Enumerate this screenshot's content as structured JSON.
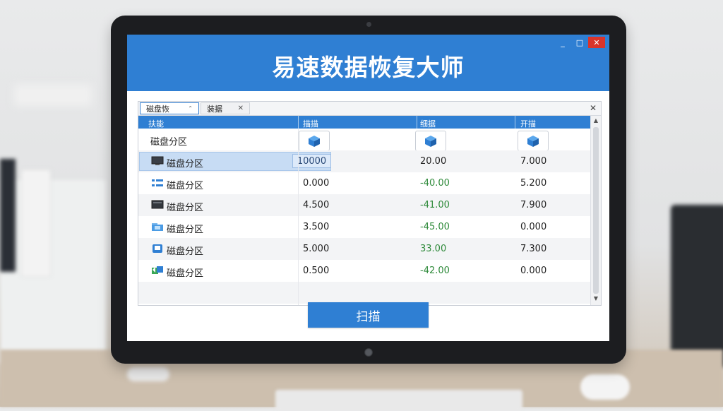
{
  "app": {
    "title": "易速数据恢复大师",
    "window_controls": [
      "_",
      "□",
      "✕"
    ]
  },
  "tabs": [
    {
      "label": "磁盘恢",
      "suffix": "⌃",
      "active": true
    },
    {
      "label": "装据",
      "suffix": "✕",
      "active": false
    }
  ],
  "panel_close": "✕",
  "table": {
    "headers": [
      "扶能",
      "描描",
      "细据",
      "开描"
    ],
    "icon_row_label": "磁盘分区",
    "rows": [
      {
        "icon": "monitor-icon",
        "name": "磁盘分区",
        "c1": "10000",
        "c2": "20.00",
        "c3": "7.000",
        "selected": true
      },
      {
        "icon": "network-icon",
        "name": "磁盘分区",
        "c1": "0.000",
        "c2": "-40.00",
        "c3": "5.200"
      },
      {
        "icon": "drive-icon",
        "name": "磁盘分区",
        "c1": "4.500",
        "c2": "-41.00",
        "c3": "7.900"
      },
      {
        "icon": "folder-icon",
        "name": "磁盘分区",
        "c1": "3.500",
        "c2": "-45.00",
        "c3": "0.000"
      },
      {
        "icon": "disk-icon",
        "name": "磁盘分区",
        "c1": "5.000",
        "c2": "33.00",
        "c3": "7.300"
      },
      {
        "icon": "recover-icon",
        "name": "磁盘分区",
        "c1": "0.500",
        "c2": "-42.00",
        "c3": "0.000"
      }
    ]
  },
  "scan_button": "扫描",
  "colors": {
    "accent": "#2f7fd3",
    "positive": "#2e8a3a",
    "selection": "#c7dcf4"
  }
}
